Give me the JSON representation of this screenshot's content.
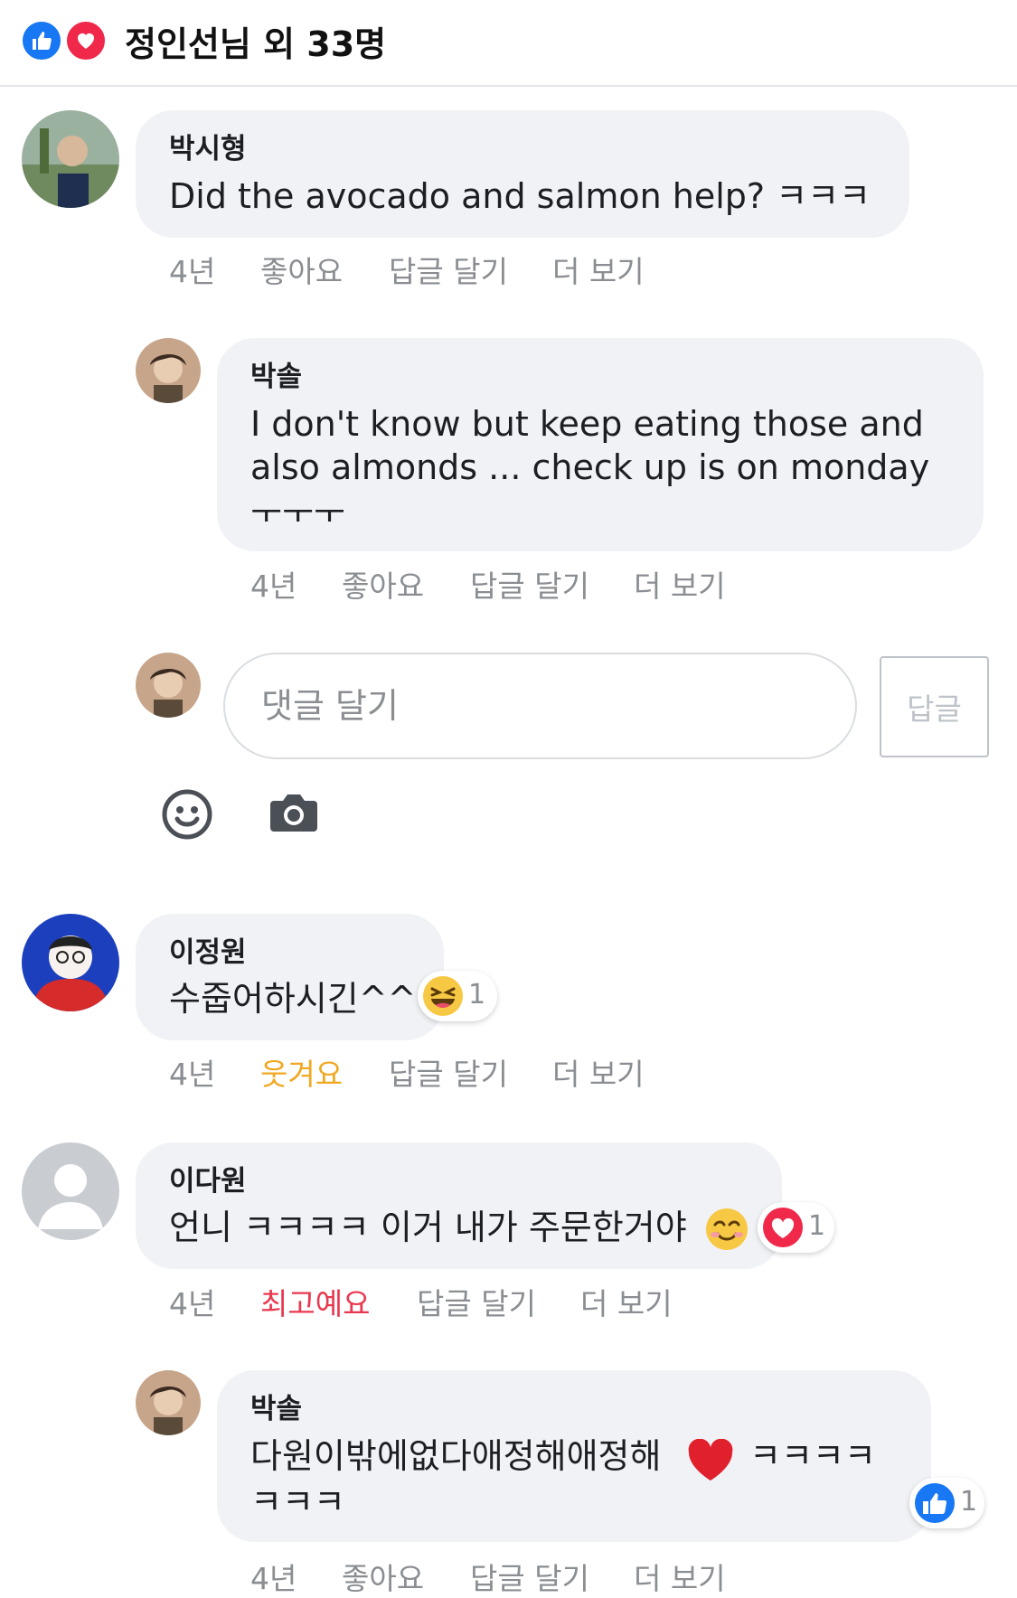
{
  "header": {
    "title": "정인선님 외 33명",
    "reactions": [
      "like-icon",
      "love-icon"
    ]
  },
  "comments": [
    {
      "author": "박시형",
      "text_lines": [
        "Did the avocado and salmon help? ㅋㅋㅋ"
      ],
      "actions": {
        "time": "4년",
        "like": "좋아요",
        "reply": "답글 달기",
        "more": "더 보기"
      }
    },
    {
      "author": "박솔",
      "text_lines": [
        "I don't know but keep eating those and",
        "also almonds ... check up is on monday",
        "ㅜㅜㅜ"
      ],
      "actions": {
        "time": "4년",
        "like": "좋아요",
        "reply": "답글 달기",
        "more": "더 보기"
      }
    },
    {
      "author": "이정원",
      "text_lines": [
        "수줍어하시긴^^"
      ],
      "reaction": {
        "type": "haha-icon",
        "count": "1"
      },
      "actions": {
        "time": "4년",
        "like": "웃겨요",
        "reply": "답글 달기",
        "more": "더 보기"
      }
    },
    {
      "author": "이다원",
      "text_lines": [
        "언니 ㅋㅋㅋㅋ 이거 내가 주문한거야"
      ],
      "reaction": {
        "type": "love-icon",
        "count": "1"
      },
      "actions": {
        "time": "4년",
        "like": "최고예요",
        "reply": "답글 달기",
        "more": "더 보기"
      }
    },
    {
      "author": "박솔",
      "text_lines": [
        "다원이밖에없다애정해애정해",
        "ㅋㅋㅋㅋ",
        "ㅋㅋㅋ"
      ],
      "reaction": {
        "type": "like-icon",
        "count": "1"
      },
      "actions": {
        "time": "4년",
        "like": "좋아요",
        "reply": "답글 달기",
        "more": "더 보기"
      }
    }
  ],
  "reply_box": {
    "placeholder": "댓글 달기",
    "submit_label": "답글",
    "tools": [
      "smiley-icon",
      "camera-icon"
    ]
  },
  "colors": {
    "like_blue": "#1877f2",
    "love_red": "#f0284a",
    "haha_yellow": "#f0a822",
    "bubble_gray": "#f0f2f5",
    "meta_gray": "#8a8d91"
  }
}
